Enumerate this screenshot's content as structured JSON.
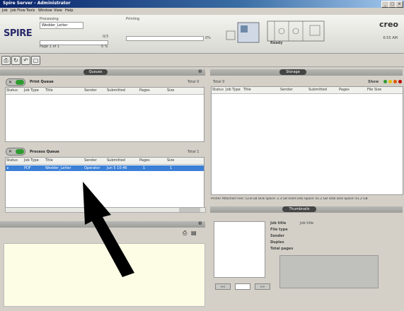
{
  "window": {
    "title": "Spire Server - Administrator",
    "min": "_",
    "max": "□",
    "close": "×"
  },
  "menu": [
    "Job",
    "Job Flow",
    "Tools",
    "Window",
    "View",
    "Help"
  ],
  "header": {
    "logo": "SPIRE",
    "brand": "creo",
    "processing_label": "Processing",
    "processing_job": "Wedder_Letter",
    "processing_count": "0/3",
    "page_label": "Page 1 of 1",
    "page_pct": "0 %",
    "printing_label": "Printing",
    "printing_pct": "0%",
    "status": "Ready",
    "time": "6:55 AM"
  },
  "toolbar": {
    "icons": [
      "import-icon",
      "refresh-icon",
      "undo-icon",
      "view-icon"
    ]
  },
  "left": {
    "tab_label": "Queues",
    "print_queue": {
      "title": "Print Queue",
      "total": "Total 0",
      "columns": [
        "Status",
        "Job Type",
        "Title",
        "Sender",
        "Submitted",
        "Pages",
        "Size"
      ]
    },
    "process_queue": {
      "title": "Process Queue",
      "total": "Total 1",
      "columns": [
        "Status",
        "Job Type",
        "Title",
        "Sender",
        "Submitted",
        "Pages",
        "Size"
      ],
      "rows": [
        {
          "status": "▸",
          "type": "PDF",
          "title": "Wedder_Letter",
          "sender": "Operator",
          "submitted": "Jun 5 10:46",
          "pages": "1",
          "size": "1"
        }
      ]
    },
    "lower_icons": [
      "print-icon",
      "list-icon"
    ]
  },
  "right": {
    "tab_label": "Storage",
    "total": "Total 0",
    "show_label": "Show",
    "columns": [
      "Status",
      "Job Type",
      "Title",
      "Sender",
      "Submitted",
      "Pages",
      "File Size"
    ],
    "disk_info": "Printer Attached Free: 53.8 GB Disk Space: 2.3 GB   Used Disk Space: 61.2 GB Total Disk Space: 61.2 GB",
    "thumb_tab": "Thumbnails",
    "details": {
      "labels": [
        "Job title",
        "File type",
        "Sender",
        "Duplex",
        "Total pages"
      ],
      "values": [
        "Job title",
        "",
        "",
        "",
        ""
      ]
    },
    "page_buttons": [
      "<<",
      ">>"
    ],
    "page_value": "",
    "show_colors": [
      "#2e9b2e",
      "#e0c000",
      "#e05a00",
      "#c00000"
    ]
  },
  "arrow": {
    "color": "#000000"
  }
}
